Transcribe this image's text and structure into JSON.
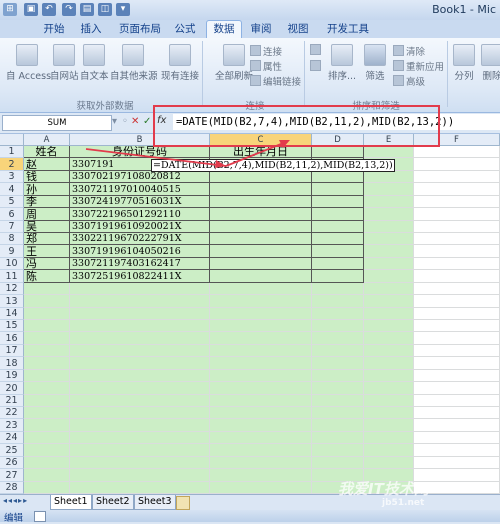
{
  "window": {
    "title": "Book1 - Mic"
  },
  "tabs": [
    "开始",
    "插入",
    "页面布局",
    "公式",
    "数据",
    "审阅",
    "视图",
    "开发工具"
  ],
  "ribbon": {
    "get_external": {
      "buttons": [
        "自 Access",
        "自网站",
        "自文本",
        "自其他来源",
        "现有连接"
      ],
      "group_label": "获取外部数据"
    },
    "connections": {
      "refresh_label": "全部刷新",
      "items": [
        "连接",
        "属性",
        "编辑链接"
      ],
      "group_label": "连接"
    },
    "sort_filter": {
      "sort_label": "排序...",
      "filter_label": "筛选",
      "items": [
        "清除",
        "重新应用",
        "高级"
      ],
      "group_label": "排序和筛选"
    },
    "tools": {
      "split_label": "分列",
      "delete_label": "删除"
    }
  },
  "formula_bar": {
    "name_box": "SUM",
    "fx": "fx",
    "formula": "=DATE(MID(B2,7,4),MID(B2,11,2),MID(B2,13,2))"
  },
  "columns": [
    "A",
    "B",
    "C",
    "D",
    "E",
    "F"
  ],
  "rows": [
    "1",
    "2",
    "3",
    "4",
    "5",
    "6",
    "7",
    "8",
    "9",
    "10",
    "11",
    "12",
    "13",
    "14",
    "15",
    "16",
    "17",
    "18",
    "19",
    "20",
    "21",
    "22",
    "23",
    "24",
    "25",
    "26",
    "27",
    "28"
  ],
  "table": {
    "header_name": "姓名",
    "header_id": "身份证号码",
    "header_birth": "出生年月日",
    "names": [
      "赵",
      "钱",
      "孙",
      "李",
      "周",
      "吴",
      "郑",
      "王",
      "冯",
      "陈"
    ],
    "ids": [
      "3307191",
      "330702197108020812",
      "330721197010040515",
      "33072419770516031X",
      "330722196501292110",
      "33071919610920021X",
      "33022119670222791X",
      "330719196104050216",
      "330721197403162417",
      "33072519610822411X"
    ],
    "editing_formula": "=DATE(MID(B2,7,4),MID(B2,11,2),MID(B2,13,2))"
  },
  "sheets": [
    "Sheet1",
    "Sheet2",
    "Sheet3"
  ],
  "status": "编辑",
  "watermark": {
    "text": "我爱IT技术网",
    "url": "jb51.net"
  },
  "colors": {
    "highlight": "#e23b4c",
    "cell_fill": "#cceec6",
    "header_sel": "#f8d47a"
  }
}
